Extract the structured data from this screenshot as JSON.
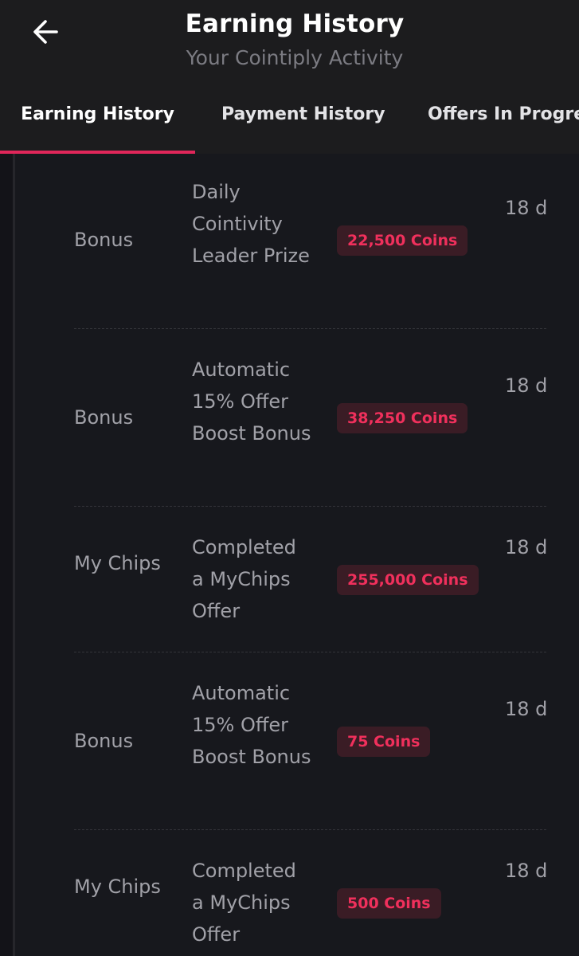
{
  "header": {
    "title": "Earning History",
    "subtitle": "Your Cointiply Activity",
    "back_icon": "arrow-left-icon"
  },
  "tabs": [
    {
      "label": "Earning History",
      "active": true
    },
    {
      "label": "Payment History",
      "active": false
    },
    {
      "label": "Offers In Progress",
      "active": false
    }
  ],
  "colors": {
    "accent": "#e0265a",
    "amount_text": "#f0305c",
    "amount_bg": "#3a1c25",
    "background": "#16171c"
  },
  "rows": [
    {
      "type": "Bonus",
      "description": "Daily Cointivity Leader Prize",
      "amount": "22,500 Coins",
      "time": "18 days ago"
    },
    {
      "type": "Bonus",
      "description": "Automatic 15% Offer Boost Bonus",
      "amount": "38,250 Coins",
      "time": "18 days ago"
    },
    {
      "type": "My Chips",
      "description": "Completed a MyChips Offer",
      "amount": "255,000 Coins",
      "time": "18 days ago"
    },
    {
      "type": "Bonus",
      "description": "Automatic 15% Offer Boost Bonus",
      "amount": "75 Coins",
      "time": "18 days ago"
    },
    {
      "type": "My Chips",
      "description": "Completed a MyChips Offer",
      "amount": "500 Coins",
      "time": "18 days ago"
    }
  ]
}
